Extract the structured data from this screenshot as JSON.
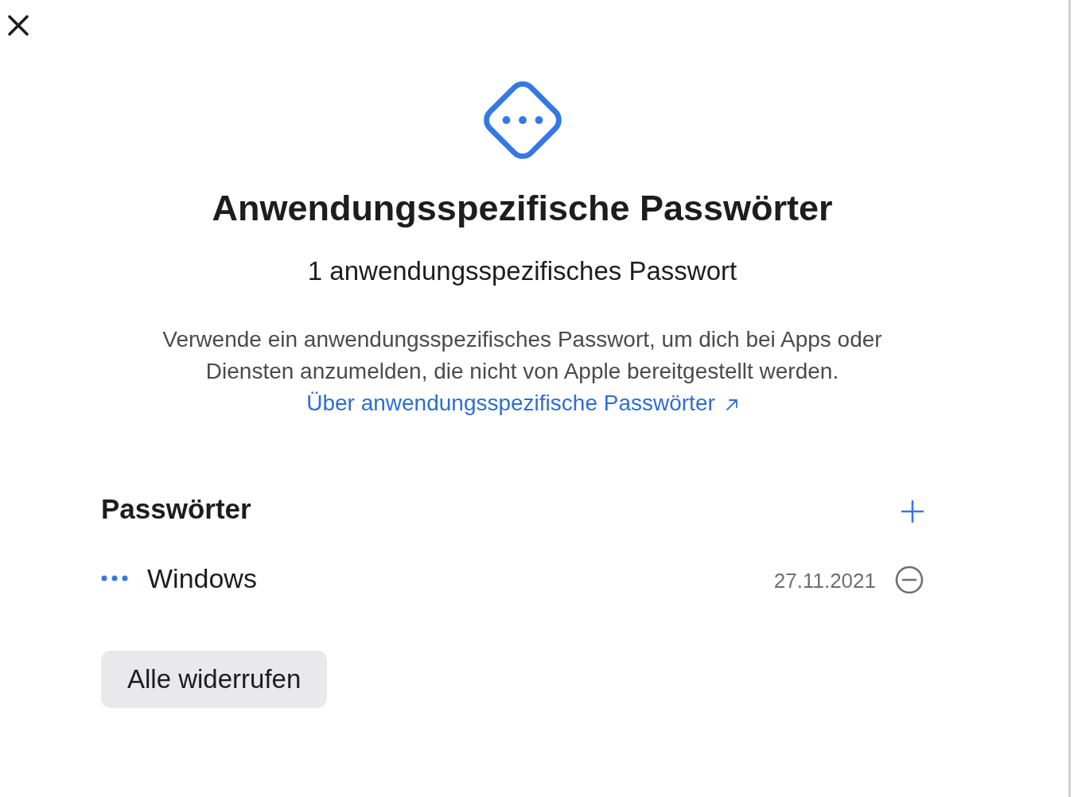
{
  "header": {
    "title": "Anwendungsspezifische Passwörter",
    "subtitle": "1 anwendungsspezifisches Passwort",
    "description": "Verwende ein anwendungsspezifisches Passwort, um dich bei Apps oder Diensten anzumelden, die nicht von Apple bereitgestellt werden.",
    "link": {
      "label": "Über anwendungsspezifische Passwörter"
    }
  },
  "section": {
    "title": "Passwörter"
  },
  "passwords": [
    {
      "name": "Windows",
      "date": "27.11.2021"
    }
  ],
  "revoke_all_button": {
    "label": "Alle widerrufen"
  }
}
